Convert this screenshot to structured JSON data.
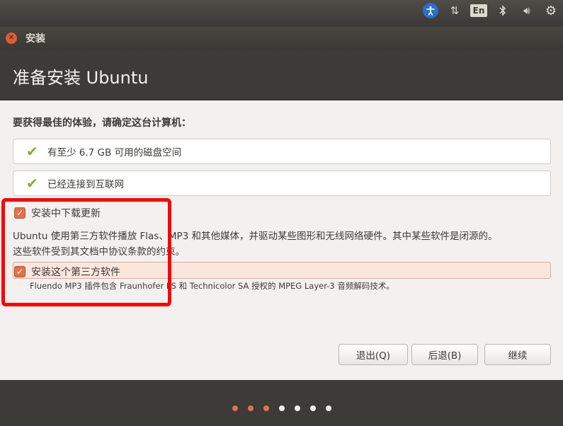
{
  "top_panel": {
    "language": "En",
    "colors": {
      "panel_bg": "#3f3d39",
      "accessibility_bg": "#2a6fc9"
    }
  },
  "window": {
    "title": "安装",
    "heading": "准备安装 Ubuntu"
  },
  "content": {
    "intro": "要获得最佳的体验，请确定这台计算机：",
    "requirements": [
      {
        "label": "有至少 6.7 GB 可用的磁盘空间",
        "met": true
      },
      {
        "label": "已经连接到互联网",
        "met": true
      }
    ],
    "option_updates": {
      "label": "安装中下载更新",
      "checked": true
    },
    "description_line1": "Ubuntu 使用第三方软件播放 Flas、MP3 和其他媒体，并驱动某些图形和无线网络硬件。其中某些软件是闭源的。",
    "description_line2": "这些软件受到其文档中协议条款的约束。",
    "option_third_party": {
      "label": "安装这个第三方软件",
      "checked": true
    },
    "third_party_note": "Fluendo MP3 插件包含 Fraunhofer IIS 和 Technicolor SA 授权的 MPEG Layer-3 音频解码技术。"
  },
  "buttons": {
    "quit": "退出(Q)",
    "back": "后退(B)",
    "continue": "继续"
  },
  "progress": {
    "total_steps": 7,
    "completed_steps": 3,
    "colors": {
      "done": "#e5704a",
      "pending": "#f2f1f0",
      "highlight": "#ff0000"
    }
  }
}
